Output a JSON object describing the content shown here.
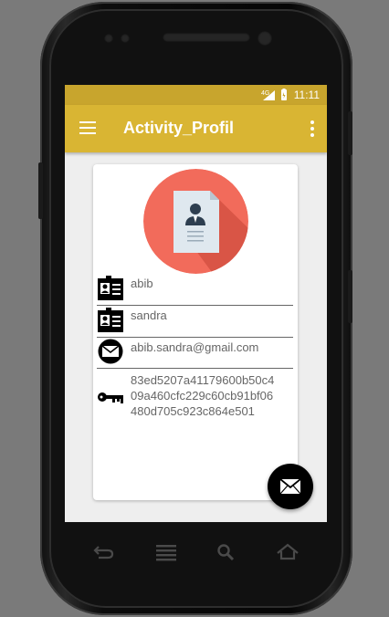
{
  "status_bar": {
    "network": "4G",
    "time": "11:11"
  },
  "app_bar": {
    "title": "Activity_Profil"
  },
  "profile": {
    "first_name": "abib",
    "last_name": "sandra",
    "email": "abib.sandra@gmail.com",
    "key_hash_lines": [
      "83ed5207a41179600b50c4",
      "09a460cfc229c60cb91bf06",
      "480d705c923c864e501"
    ]
  },
  "icons": {
    "menu": "hamburger-menu-icon",
    "overflow": "more-vert-icon",
    "avatar": "profile-document-icon",
    "first_name": "id-card-icon",
    "last_name": "id-card-icon",
    "email": "envelope-icon",
    "key": "key-icon",
    "fab": "envelope-icon"
  },
  "colors": {
    "status_bar": "#c8a52d",
    "app_bar": "#d9b533",
    "avatar_bg": "#f26b5b",
    "fab": "#000000"
  }
}
